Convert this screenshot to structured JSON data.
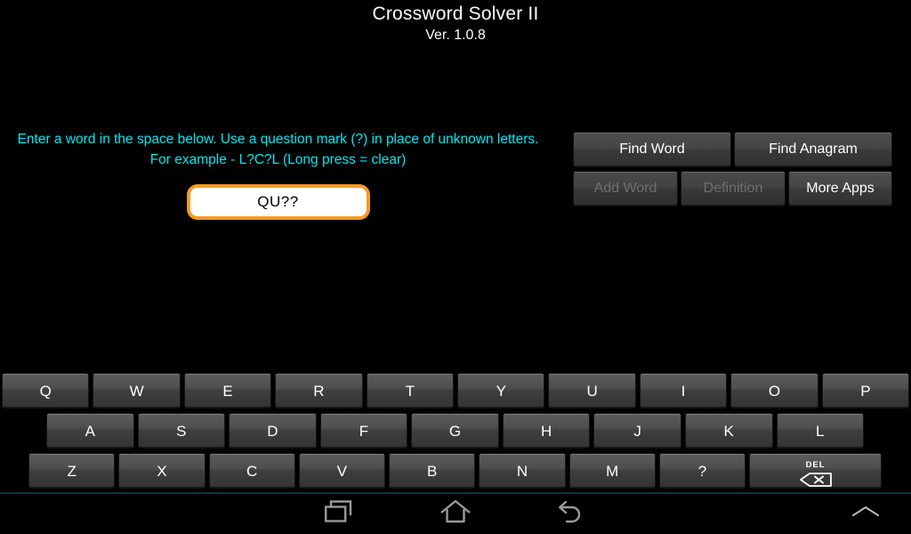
{
  "app": {
    "title": "Crossword Solver II",
    "version": "Ver. 1.0.8",
    "background_color": "#000000"
  },
  "instructions": {
    "line1": "Enter a word in the space below. Use a question mark (?) in place of unknown letters.",
    "line2": "For example - L?C?L (Long press = clear)",
    "text_color": "#00e8f0"
  },
  "word_input": {
    "value": "QU??",
    "placeholder": "",
    "border_color": "#fa9a22",
    "background_color": "#ffffff",
    "text_color": "#000000"
  },
  "actions": {
    "rows": [
      [
        {
          "id": "find-word",
          "label": "Find Word",
          "enabled": true
        },
        {
          "id": "find-anagram",
          "label": "Find Anagram",
          "enabled": true
        }
      ],
      [
        {
          "id": "add-word",
          "label": "Add Word",
          "enabled": false
        },
        {
          "id": "definition",
          "label": "Definition",
          "enabled": false
        },
        {
          "id": "more-apps",
          "label": "More Apps",
          "enabled": true
        }
      ]
    ],
    "enabled_text_color": "#ffffff",
    "disabled_text_color": "#6f6f6f"
  },
  "keyboard": {
    "row1": [
      "Q",
      "W",
      "E",
      "R",
      "T",
      "Y",
      "U",
      "I",
      "O",
      "P"
    ],
    "row2": [
      "A",
      "S",
      "D",
      "F",
      "G",
      "H",
      "J",
      "K",
      "L"
    ],
    "row3": [
      "Z",
      "X",
      "C",
      "V",
      "B",
      "N",
      "M",
      "?"
    ],
    "delete_key": {
      "label": "DEL",
      "icon": "backspace-icon"
    },
    "key_text_color": "#ffffff"
  },
  "navbar": {
    "recent_icon": "recent-apps-icon",
    "home_icon": "home-icon",
    "back_icon": "back-icon",
    "expand_icon": "chevron-up-icon",
    "icon_color": "#9a9a9a",
    "separator_color": "#12323c"
  }
}
